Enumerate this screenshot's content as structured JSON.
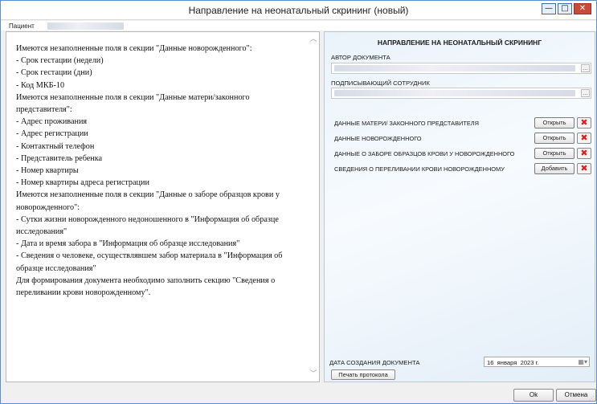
{
  "window": {
    "title": "Направление на неонатальный скрининг (новый)",
    "minimize_glyph": "—",
    "maximize_glyph": "□",
    "close_glyph": "✕"
  },
  "patient": {
    "label": "Пациент"
  },
  "messages": [
    "Имеются незаполненные поля в секции \"Данные новорожденного\":",
    "- Срок гестации (недели)",
    "- Срок гестации (дни)",
    "- Код МКБ-10",
    "Имеются незаполненные поля в секции \"Данные матери/законного представителя\":",
    "- Адрес проживания",
    "- Адрес регистрации",
    "- Контактный телефон",
    "- Представитель ребенка",
    "- Номер квартиры",
    "- Номер квартиры адреса регистрации",
    "Имеются незаполненные поля в секции \"Данные о заборе образцов крови у новорожденного\":",
    "- Сутки жизни новорожденного недоношенного в \"Информация об образце исследования\"",
    "- Дата и время забора в \"Информация об образце исследования\"",
    "- Сведения о человеке, осуществлявшем забор материала в \"Информация об образце исследования\"",
    "Для формирования документа необходимо заполнить секцию \"Сведения о переливании крови новорожденному\"."
  ],
  "form": {
    "title": "НАПРАВЛЕНИЕ НА НЕОНАТАЛЬНЫЙ СКРИНИНГ",
    "author_label": "АВТОР ДОКУМЕНТА",
    "signer_label": "ПОДПИСЫВАЮЩИЙ СОТРУДНИК",
    "ellipsis": "...",
    "sections": [
      {
        "label": "ДАННЫЕ МАТЕРИ/ ЗАКОННОГО ПРЕДСТАВИТЕЛЯ",
        "button": "Открыть"
      },
      {
        "label": "ДАННЫЕ НОВОРОЖДЕННОГО",
        "button": "Открыть"
      },
      {
        "label": "ДАННЫЕ О ЗАБОРЕ ОБРАЗЦОВ КРОВИ У НОВОРОЖДЕННОГО",
        "button": "Открыть"
      },
      {
        "label": "СВЕДЕНИЯ О ПЕРЕЛИВАНИИ КРОВИ НОВОРОЖДЕННОМУ",
        "button": "Добавить"
      }
    ],
    "delete_glyph": "✖",
    "date_label": "ДАТА СОЗДАНИЯ ДОКУМЕНТА",
    "date_value": "16  января  2023 г.",
    "print_button": "Печать протокола"
  },
  "footer": {
    "ok": "Ok",
    "cancel": "Отмена"
  },
  "colors": {
    "delete_icon": "#dd2222",
    "window_border": "#5a8fc9"
  }
}
